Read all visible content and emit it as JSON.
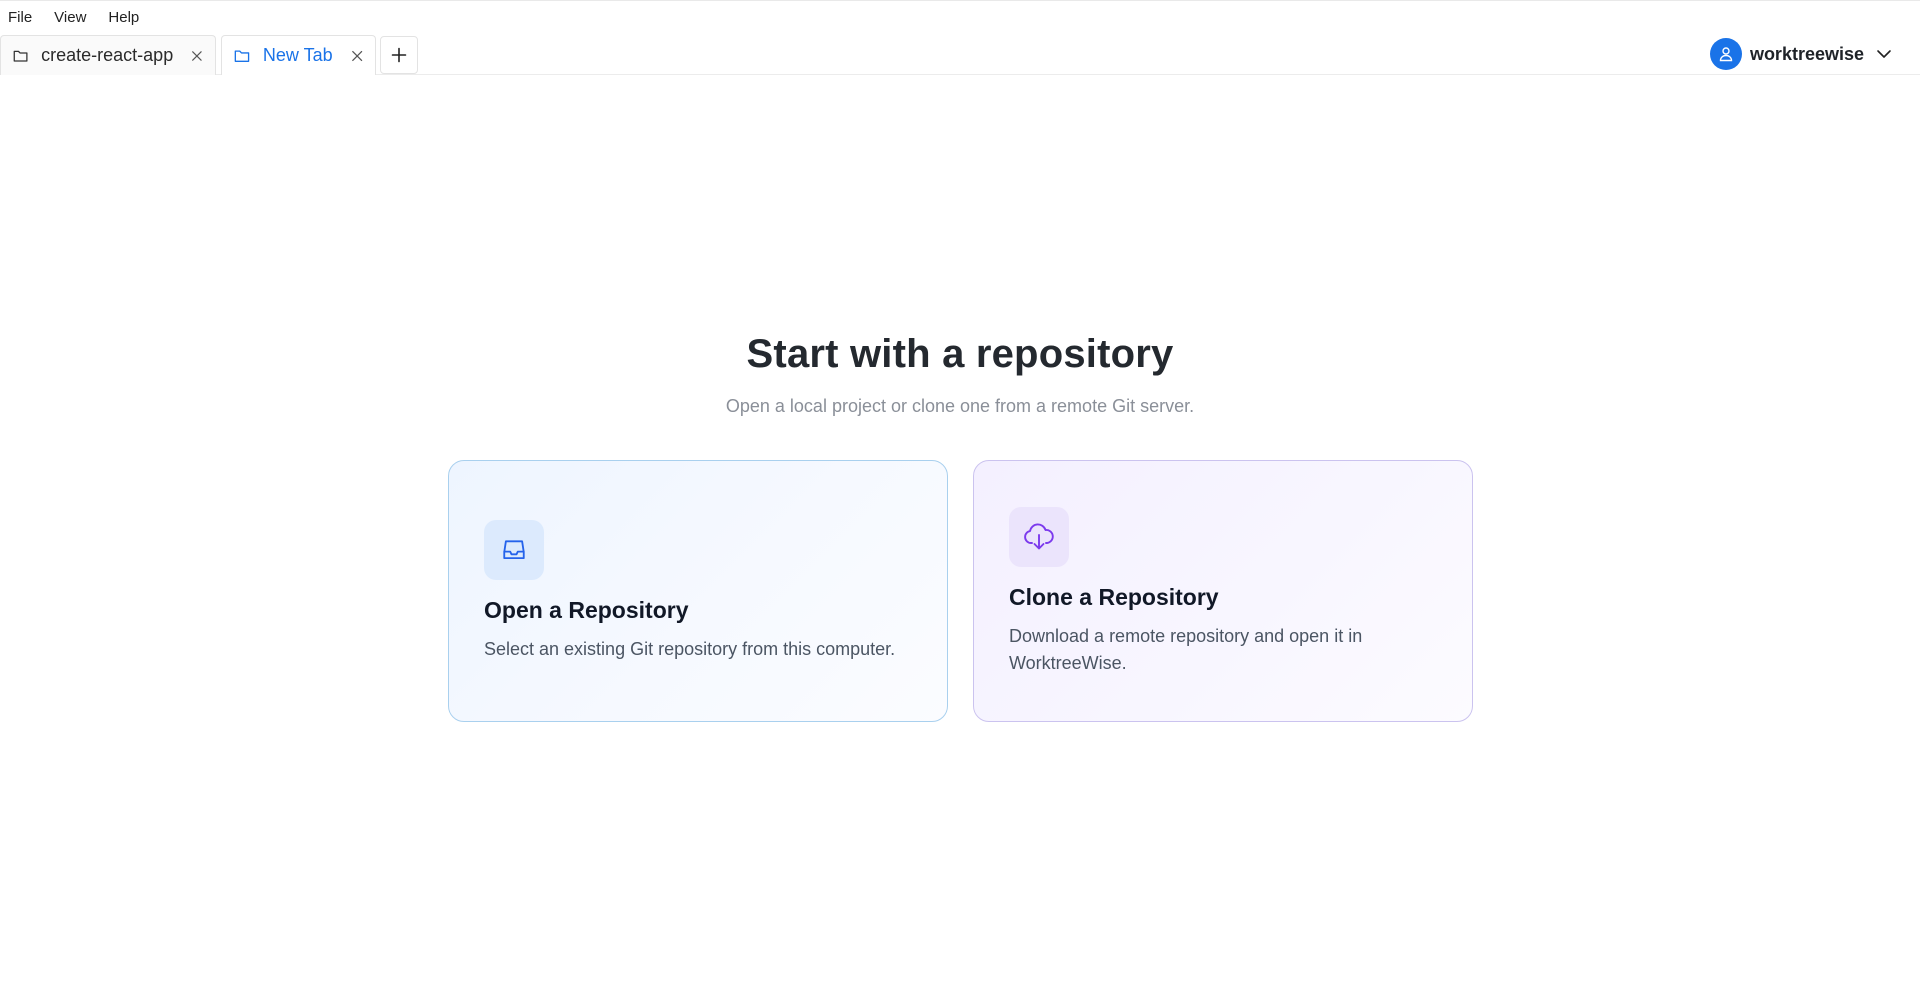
{
  "menubar": {
    "items": [
      "File",
      "View",
      "Help"
    ]
  },
  "tabs": [
    {
      "label": "create-react-app",
      "icon": "folder-icon",
      "active": false
    },
    {
      "label": "New Tab",
      "icon": "folder-icon",
      "active": true
    }
  ],
  "user": {
    "name": "worktreewise",
    "avatar_icon": "user-icon",
    "accent": "#1a73e8"
  },
  "main": {
    "title": "Start with a repository",
    "subtitle": "Open a local project or clone one from a remote Git server.",
    "cards": [
      {
        "title": "Open a Repository",
        "description": "Select an existing Git repository from this computer.",
        "icon": "inbox-icon",
        "color": "#2563eb"
      },
      {
        "title": "Clone a Repository",
        "description": "Download a remote repository and open it in WorktreeWise.",
        "icon": "cloud-download-icon",
        "color": "#7c3aed"
      }
    ]
  }
}
